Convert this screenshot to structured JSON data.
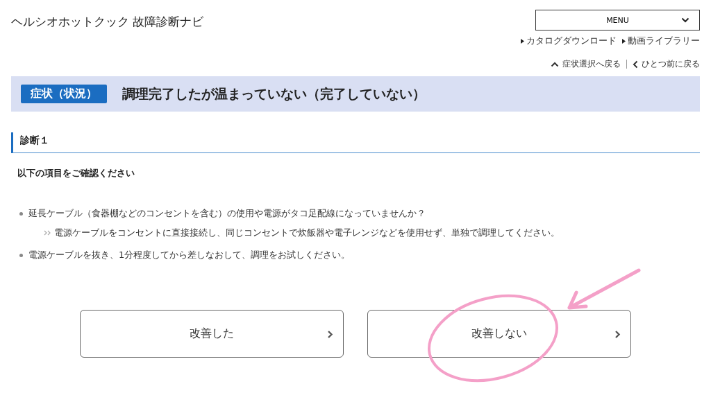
{
  "header": {
    "title": "ヘルシオホットクック 故障診断ナビ",
    "menu": "MENU",
    "links": [
      "カタログダウンロード",
      "動画ライブラリー"
    ]
  },
  "back_links": [
    {
      "kind": "up",
      "label": "症状選択へ戻る"
    },
    {
      "kind": "left",
      "label": "ひとつ前に戻る"
    }
  ],
  "symptom": {
    "badge": "症状（状況）",
    "text": "調理完了したが温まっていない（完了していない）"
  },
  "diagnosis": {
    "heading": "診断１",
    "instruction": "以下の項目をご確認ください",
    "items": [
      {
        "text": "延長ケーブル（食器棚などのコンセントを含む）の使用や電源がタコ足配線になっていませんか？",
        "note": "電源ケーブルをコンセントに直接接続し、同じコンセントで炊飯器や電子レンジなどを使用せず、単独で調理してください。"
      },
      {
        "text": "電源ケーブルを抜き、1分程度してから差しなおして、調理をお試しください。"
      }
    ]
  },
  "buttons": [
    "改善した",
    "改善しない"
  ]
}
